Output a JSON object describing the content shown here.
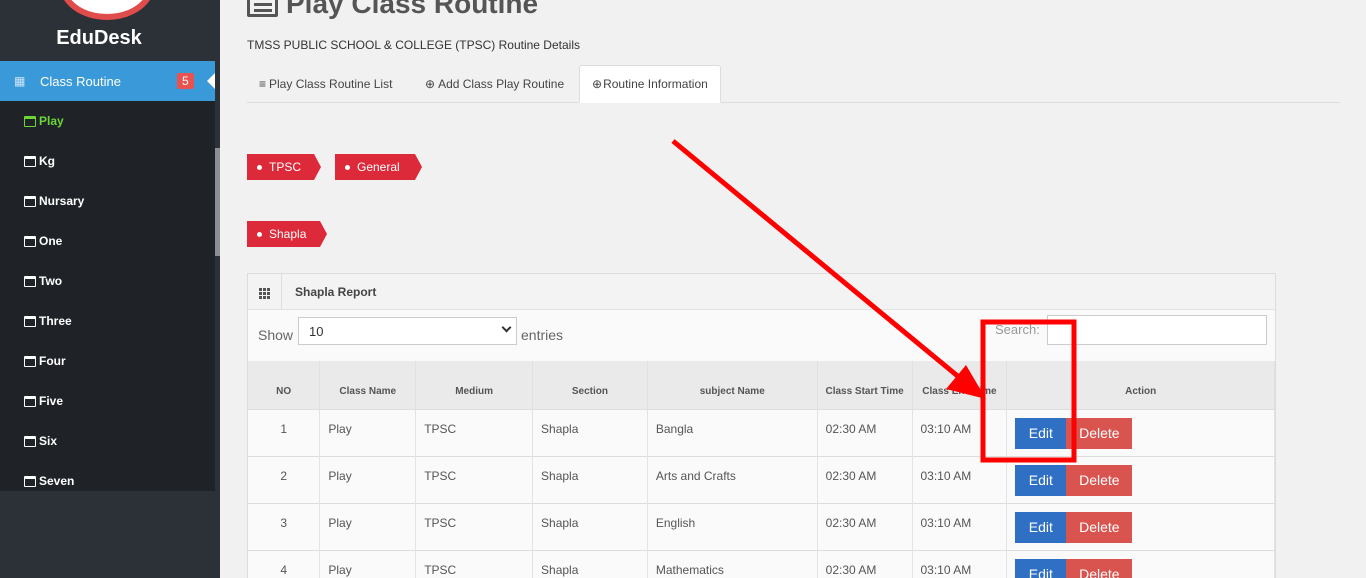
{
  "brand": {
    "name": "EduDesk"
  },
  "sidebar": {
    "active_menu": {
      "label": "Class Routine",
      "badge": "5"
    },
    "items": [
      {
        "label": "Play",
        "active": true
      },
      {
        "label": "Kg"
      },
      {
        "label": "Nursary"
      },
      {
        "label": "One"
      },
      {
        "label": "Two"
      },
      {
        "label": "Three"
      },
      {
        "label": "Four"
      },
      {
        "label": "Five"
      },
      {
        "label": "Six"
      },
      {
        "label": "Seven"
      }
    ]
  },
  "header": {
    "title": "Play Class Routine",
    "subtitle": "TMSS PUBLIC SCHOOL & COLLEGE (TPSC) Routine Details"
  },
  "tabs": [
    {
      "label": "Play Class Routine List",
      "icon": "bars-icon"
    },
    {
      "label": "Add Class Play Routine",
      "icon": "plus-circle-icon"
    },
    {
      "label": "Routine Information",
      "icon": "plus-circle-icon",
      "active": true
    }
  ],
  "tags": {
    "medium": "TPSC",
    "group": "General",
    "section": "Shapla"
  },
  "report": {
    "title": "Shapla Report",
    "show_label": "Show",
    "entries_value": "10",
    "entries_label": "entries",
    "search_label": "Search:",
    "columns": [
      "NO",
      "Class Name",
      "Medium",
      "Section",
      "subject Name",
      "Class Start Time",
      "Class End Time",
      "Action"
    ],
    "rows": [
      {
        "no": "1",
        "class": "Play",
        "medium": "TPSC",
        "section": "Shapla",
        "subject": "Bangla",
        "start": "02:30 AM",
        "end": "03:10 AM"
      },
      {
        "no": "2",
        "class": "Play",
        "medium": "TPSC",
        "section": "Shapla",
        "subject": "Arts and Crafts",
        "start": "02:30 AM",
        "end": "03:10 AM"
      },
      {
        "no": "3",
        "class": "Play",
        "medium": "TPSC",
        "section": "Shapla",
        "subject": "English",
        "start": "02:30 AM",
        "end": "03:10 AM"
      },
      {
        "no": "4",
        "class": "Play",
        "medium": "TPSC",
        "section": "Shapla",
        "subject": "Mathematics",
        "start": "02:30 AM",
        "end": "03:10 AM"
      }
    ],
    "edit_label": "Edit",
    "delete_label": "Delete"
  },
  "colors": {
    "annotation": "#ff0000",
    "accent": "#3a9ad9",
    "tag": "#dc2a3a"
  }
}
